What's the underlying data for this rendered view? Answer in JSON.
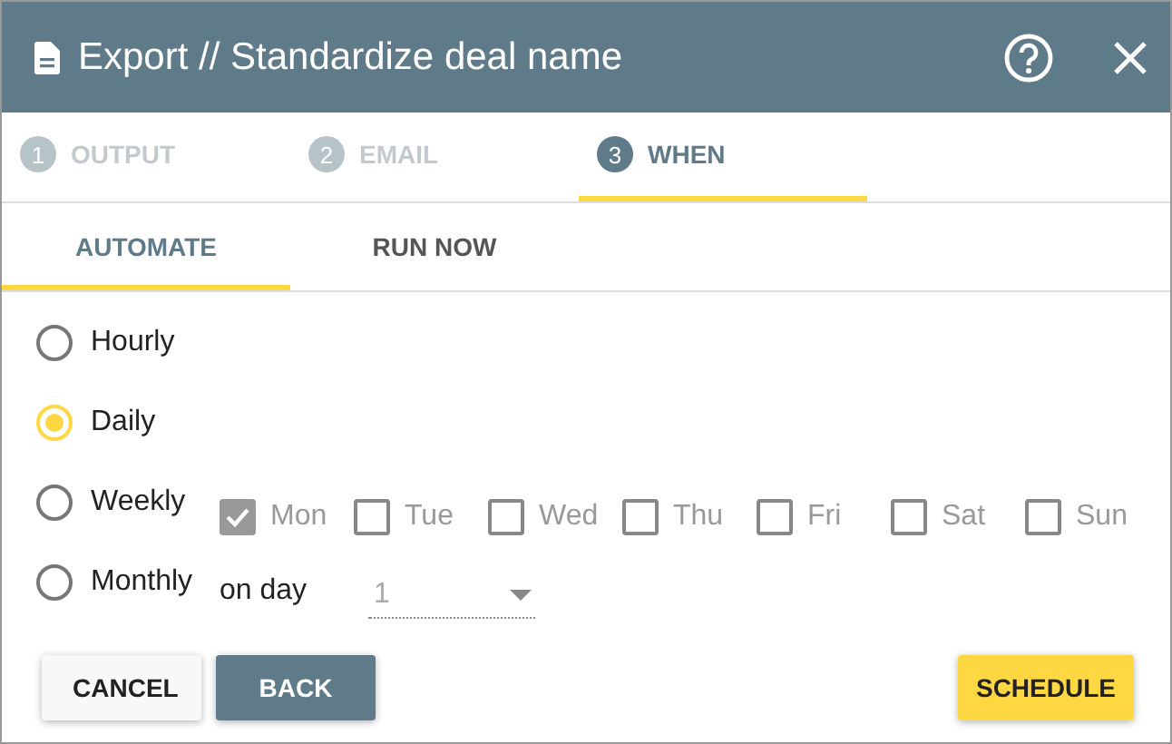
{
  "window": {
    "title": "Export // Standardize deal name"
  },
  "steps": [
    {
      "number": "1",
      "label": "OUTPUT",
      "selected": false
    },
    {
      "number": "2",
      "label": "EMAIL",
      "selected": false
    },
    {
      "number": "3",
      "label": "WHEN",
      "selected": true
    }
  ],
  "tabs": [
    {
      "label": "AUTOMATE",
      "selected": true
    },
    {
      "label": "RUN NOW",
      "selected": false
    }
  ],
  "frequency": [
    {
      "kind": "plain",
      "label": "Hourly",
      "selected": false
    },
    {
      "kind": "plain",
      "label": "Daily",
      "selected": true
    },
    {
      "kind": "days",
      "label": "Weekly",
      "selected": false,
      "days": [
        {
          "label": "Mon",
          "checked": true,
          "disabled": true
        },
        {
          "label": "Tue",
          "checked": false,
          "disabled": true
        },
        {
          "label": "Wed",
          "checked": false,
          "disabled": true
        },
        {
          "label": "Thu",
          "checked": false,
          "disabled": true
        },
        {
          "label": "Fri",
          "checked": false,
          "disabled": true
        },
        {
          "label": "Sat",
          "checked": false,
          "disabled": true
        },
        {
          "label": "Sun",
          "checked": false,
          "disabled": true
        }
      ]
    },
    {
      "kind": "monthday",
      "label": "Monthly",
      "selected": false,
      "prefix": "on day",
      "value": "1",
      "disabled": true
    }
  ],
  "buttons": [
    {
      "kind": "flat",
      "label": "CANCEL"
    },
    {
      "kind": "dark",
      "label": "BACK"
    },
    {
      "kind": "primary",
      "label": "SCHEDULE"
    }
  ]
}
